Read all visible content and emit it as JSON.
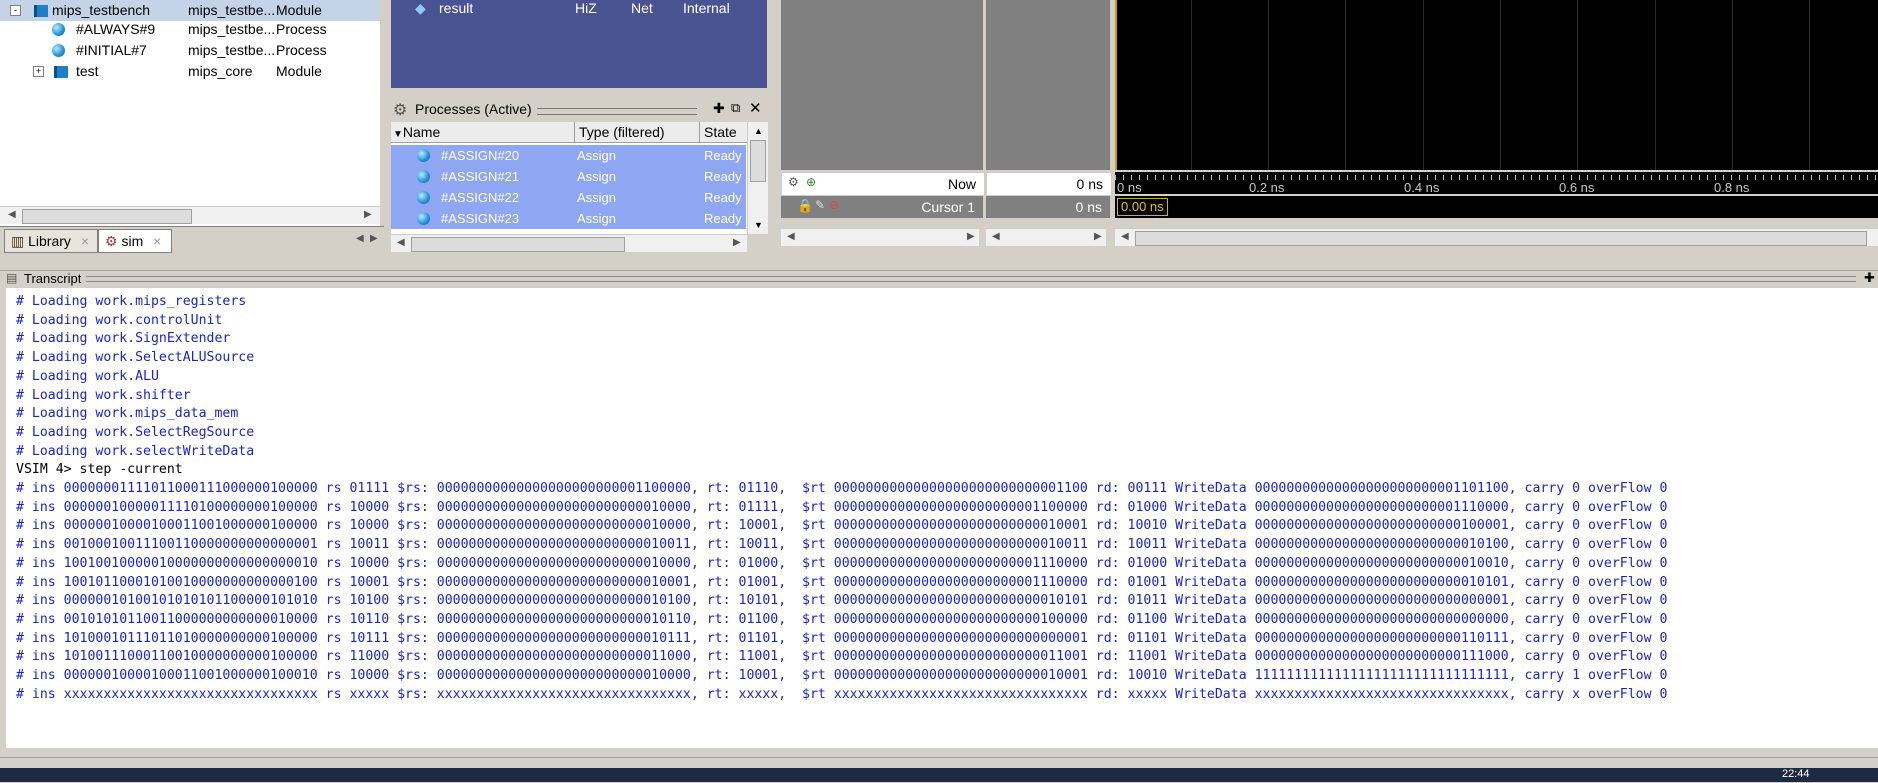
{
  "structure": {
    "rows": [
      {
        "name": "mips_testbench",
        "design_unit": "mips_testbe...",
        "type": "Module",
        "expander": "-",
        "selected": true
      },
      {
        "name": "#ALWAYS#9",
        "design_unit": "mips_testbe...",
        "type": "Process"
      },
      {
        "name": "#INITIAL#7",
        "design_unit": "mips_testbe...",
        "type": "Process"
      },
      {
        "name": "test",
        "design_unit": "mips_core",
        "type": "Module",
        "expander": "+"
      }
    ],
    "tabs": [
      {
        "label": "Library",
        "close": "×"
      },
      {
        "label": "sim",
        "close": "×"
      }
    ]
  },
  "objects": {
    "row": {
      "name": "result",
      "mode": "HiZ",
      "kind": "Net",
      "scope": "Internal"
    }
  },
  "processes": {
    "title": "Processes (Active)",
    "columns": [
      "Name",
      "Type (filtered)",
      "State"
    ],
    "rows": [
      {
        "name": "#ASSIGN#20",
        "type": "Assign",
        "state": "Ready"
      },
      {
        "name": "#ASSIGN#21",
        "type": "Assign",
        "state": "Ready"
      },
      {
        "name": "#ASSIGN#22",
        "type": "Assign",
        "state": "Ready"
      },
      {
        "name": "#ASSIGN#23",
        "type": "Assign",
        "state": "Ready"
      }
    ]
  },
  "wave": {
    "now_label": "Now",
    "now_value": "0 ns",
    "cursor_label": "Cursor 1",
    "cursor_value": "0 ns",
    "cursor_marker": "0.00 ns",
    "ticks": [
      "0 ns",
      "0.2 ns",
      "0.4 ns",
      "0.6 ns",
      "0.8 ns"
    ]
  },
  "transcript": {
    "title": "Transcript",
    "lines": [
      "# Loading work.mips_registers",
      "# Loading work.controlUnit",
      "# Loading work.SignExtender",
      "# Loading work.SelectALUSource",
      "# Loading work.ALU",
      "# Loading work.shifter",
      "# Loading work.mips_data_mem",
      "# Loading work.SelectRegSource",
      "# Loading work.selectWriteData",
      "VSIM 4> step -current",
      "# ins 00000001111011000111000000100000 rs 01111 $rs: 00000000000000000000000001100000, rt: 01110,  $rt 00000000000000000000000000001100 rd: 00111 WriteData 00000000000000000000000001101100, carry 0 overFlow 0",
      "# ins 00000010000011110100000000100000 rs 10000 $rs: 00000000000000000000000000010000, rt: 01111,  $rt 00000000000000000000000001100000 rd: 01000 WriteData 00000000000000000000000001110000, carry 0 overFlow 0",
      "# ins 00000010000100011001000000100000 rs 10000 $rs: 00000000000000000000000000010000, rt: 10001,  $rt 00000000000000000000000000010001 rd: 10010 WriteData 00000000000000000000000000100001, carry 0 overFlow 0",
      "# ins 00100010011100110000000000000001 rs 10011 $rs: 00000000000000000000000000010011, rt: 10011,  $rt 00000000000000000000000000010011 rd: 10011 WriteData 00000000000000000000000000010100, carry 0 overFlow 0",
      "# ins 10010010000010000000000000000010 rs 10000 $rs: 00000000000000000000000000010000, rt: 01000,  $rt 00000000000000000000000001110000 rd: 01000 WriteData 00000000000000000000000000010010, carry 0 overFlow 0",
      "# ins 10010110001010010000000000000100 rs 10001 $rs: 00000000000000000000000000010001, rt: 01001,  $rt 00000000000000000000000001110000 rd: 01001 WriteData 00000000000000000000000000010101, carry 0 overFlow 0",
      "# ins 00000010100101010101100000101010 rs 10100 $rs: 00000000000000000000000000010100, rt: 10101,  $rt 00000000000000000000000000010101 rd: 01011 WriteData 00000000000000000000000000000001, carry 0 overFlow 0",
      "# ins 00101010110011000000000000010000 rs 10110 $rs: 00000000000000000000000000010110, rt: 01100,  $rt 00000000000000000000000000100000 rd: 01100 WriteData 00000000000000000000000000000000, carry 0 overFlow 0",
      "# ins 10100010111011010000000000100000 rs 10111 $rs: 00000000000000000000000000010111, rt: 01101,  $rt 00000000000000000000000000000001 rd: 01101 WriteData 00000000000000000000000000110111, carry 0 overFlow 0",
      "# ins 10100111000110010000000000100000 rs 11000 $rs: 00000000000000000000000000011000, rt: 11001,  $rt 00000000000000000000000000011001 rd: 11001 WriteData 00000000000000000000000000111000, carry 0 overFlow 0",
      "# ins 00000010000100011001000000100010 rs 10000 $rs: 00000000000000000000000000010000, rt: 10001,  $rt 00000000000000000000000000010001 rd: 10010 WriteData 11111111111111111111111111111111, carry 1 overFlow 0",
      "# ins xxxxxxxxxxxxxxxxxxxxxxxxxxxxxxxx rs xxxxx $rs: xxxxxxxxxxxxxxxxxxxxxxxxxxxxxxxx, rt: xxxxx,  $rt xxxxxxxxxxxxxxxxxxxxxxxxxxxxxxxx rd: xxxxx WriteData xxxxxxxxxxxxxxxxxxxxxxxxxxxxxxxx, carry x overFlow 0"
    ]
  },
  "taskbar": {
    "clock": "22:44"
  }
}
